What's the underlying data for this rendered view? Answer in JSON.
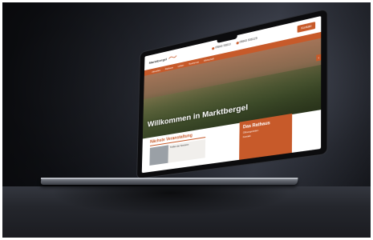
{
  "site": {
    "logo_text": "Marktbergel",
    "contacts": [
      "09843 93610",
      "09843 936129"
    ],
    "cta_label": "Kontakt",
    "nav": [
      "Aktuelles",
      "Rathaus",
      "Leben",
      "Tourismus",
      "Wirtschaft"
    ],
    "hero_title": "Willkommen in Marktbergel",
    "hero_arrow": "›",
    "events_label": "Nächste Veranstaltung",
    "event_text": "Treffen der Senioren",
    "rathaus_title": "Das Rathaus",
    "rathaus_lines": [
      "Öffnungszeiten",
      "Kontakt"
    ]
  },
  "colors": {
    "accent": "#c75a2a"
  }
}
